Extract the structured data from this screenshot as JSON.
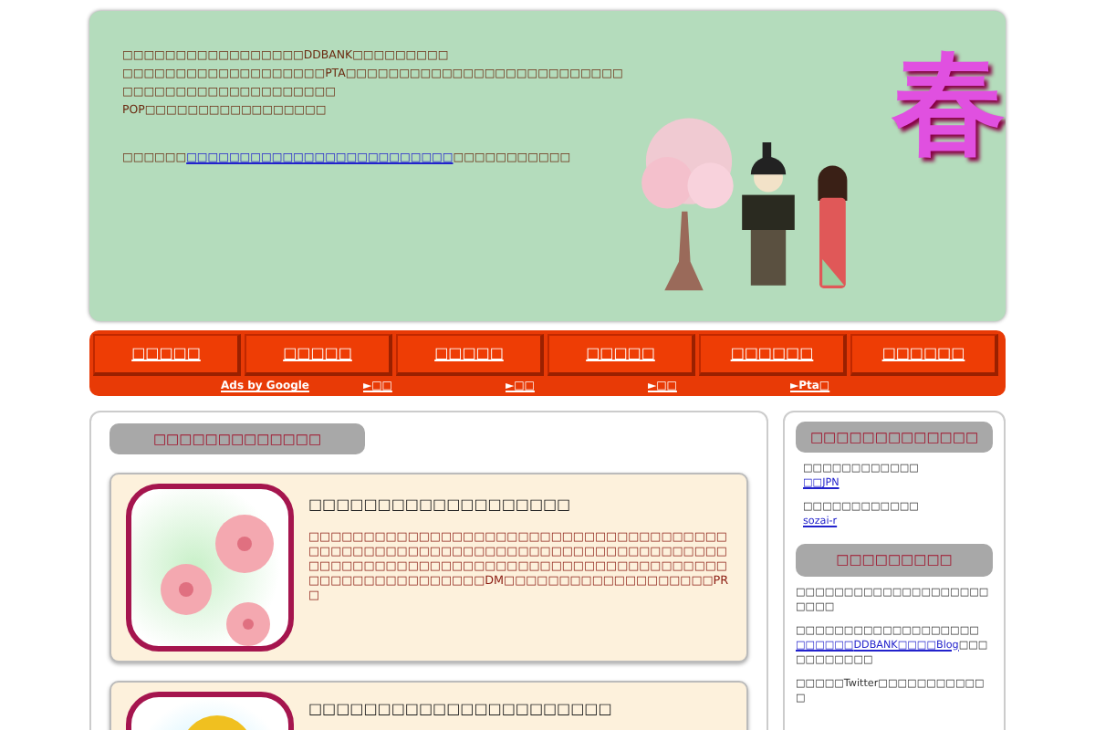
{
  "header": {
    "lines": [
      "□□□□□□□□□□□□□□□□□DDBANK□□□□□□□□□",
      "□□□□□□□□□□□□□□□□□□□PTA□□□□□□□□□□□□□□□□□□□□□□□□□□",
      "□□□□□□□□□□□□□□□□□□□□",
      "POP□□□□□□□□□□□□□□□□□"
    ],
    "link_line": {
      "before": "□□□□□□",
      "link": "□□□□□□□□□□□□□□□□□□□□□□□□□",
      "after": "□□□□□□□□□□□"
    },
    "banner_glyph": "春"
  },
  "nav": {
    "items": [
      "□□□□□",
      "□□□□□",
      "□□□□□",
      "□□□□□",
      "□□□□□□",
      "□□□□□□"
    ],
    "ads_label": "Ads by Google",
    "ad_links": [
      "►□□",
      "►□□",
      "►□□",
      "►Pta□"
    ]
  },
  "main": {
    "heading": "□□□□□□□□□□□□□",
    "articles": [
      {
        "kind": "blossom",
        "title": "□□□□□□□□□□□□□□□□□□□",
        "body": "□□□□□□□□□□□□□□□□□□□□□□□□□□□□□□□□□□□□□□□□□□□□□□□□□□□□□□□□□□□□□□□□□□□□□□□□□□□□□□□□□□□□□□□□□□□□□□□□□□□□□□□□□□□□□□□□□□□□□□□□□□□□□□□□□□DM□□□□□□□□□□□□□□□□□□□PR□"
      },
      {
        "kind": "sunflower",
        "title": "□□□□□□□□□□□□□□□□□□□□□□"
      }
    ]
  },
  "sidebar": {
    "sections": [
      {
        "heading": "□□□□□□□□□□□□□",
        "entries": [
          {
            "text": "□□□□□□□□□□□□",
            "link": "□□JPN"
          },
          {
            "text": "□□□□□□□□□□□□",
            "link": "sozai-r"
          }
        ]
      },
      {
        "heading": "□□□□□□□□□",
        "paragraphs": [
          [
            {
              "text": "□□□□□□□□□□□□□□□□□□□□□□□□"
            }
          ],
          [
            {
              "text": "□□□□□□□□□□□□□□□□□□□"
            },
            {
              "link": "□□□□□□"
            },
            {
              "link": "DDBANK□□□□Blog"
            },
            {
              "text": "□□□□□□□□□□□"
            }
          ],
          [
            {
              "text": "□□□□□Twitter□□□□□□□□□□□□"
            }
          ]
        ]
      }
    ]
  }
}
